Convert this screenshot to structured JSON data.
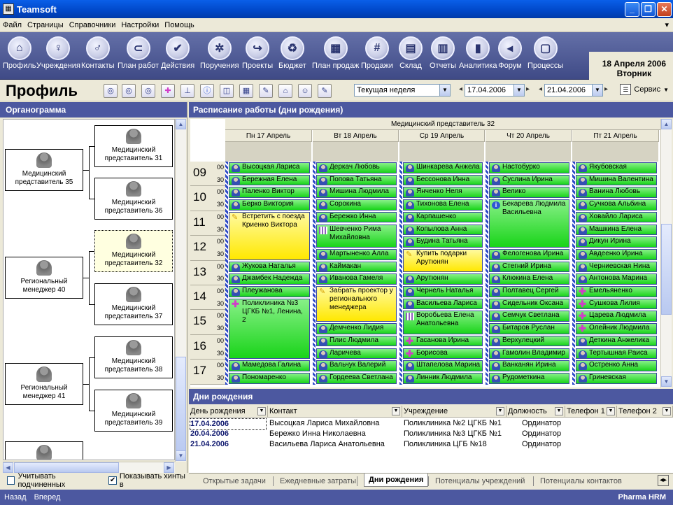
{
  "window": {
    "title": "Teamsoft",
    "minimize": "_",
    "restore": "❐",
    "close": "✕"
  },
  "menu": [
    "Файл",
    "Страницы",
    "Справочники",
    "Настройки",
    "Помощь"
  ],
  "toolbar": [
    {
      "label": "Профиль",
      "icon": "home-icon",
      "glyph": "⌂"
    },
    {
      "label": "Учреждения",
      "icon": "people-icon",
      "glyph": "♀"
    },
    {
      "label": "Контакты",
      "icon": "person-walk-icon",
      "glyph": "♂"
    },
    {
      "label": "План работ",
      "icon": "paperclip-icon",
      "glyph": "⊂"
    },
    {
      "label": "Действия",
      "icon": "checkmark-icon",
      "glyph": "✔"
    },
    {
      "label": "Поручения",
      "icon": "gears-icon",
      "glyph": "✲"
    },
    {
      "label": "Проекты",
      "icon": "arrow-icon",
      "glyph": "↪"
    },
    {
      "label": "Бюджет",
      "icon": "recycle-icon",
      "glyph": "♻"
    },
    {
      "label": "План продаж",
      "icon": "grid-icon",
      "glyph": "▦"
    },
    {
      "label": "Продажи",
      "icon": "hash-icon",
      "glyph": "#"
    },
    {
      "label": "Склад",
      "icon": "cabinet-icon",
      "glyph": "▤"
    },
    {
      "label": "Отчеты",
      "icon": "document-icon",
      "glyph": "▥"
    },
    {
      "label": "Аналитика",
      "icon": "bar-chart-icon",
      "glyph": "▮"
    },
    {
      "label": "Форум",
      "icon": "megaphone-icon",
      "glyph": "◂"
    },
    {
      "label": "Процессы",
      "icon": "film-icon",
      "glyph": "▢"
    }
  ],
  "date": {
    "line1": "18 Апреля 2006",
    "line2": "Вторник"
  },
  "page_title": "Профиль",
  "period": {
    "value": "Текущая неделя",
    "from": "17.04.2006",
    "to": "21.04.2006"
  },
  "service_label": "Сервис",
  "org": {
    "title": "Органограмма",
    "nodes": [
      {
        "label": "Медицинский представитель 35"
      },
      {
        "label": "Медицинский представитель 31"
      },
      {
        "label": "Медицинский представитель 36"
      },
      {
        "label": "Медицинский представитель 32"
      },
      {
        "label": "Региональный менеджер 40"
      },
      {
        "label": "Медицинский представитель 37"
      },
      {
        "label": "Медицинский представитель 38"
      },
      {
        "label": "Региональный менеджер 41"
      },
      {
        "label": "Медицинский представитель 39"
      }
    ],
    "check1": "Учитывать подчиненных",
    "check2": "Показывать хинты в",
    "check2_checked": "✔"
  },
  "schedule": {
    "title": "Расписание работы (дни рождения)",
    "resource": "Медицинский представитель 32",
    "days": [
      "Пн 17 Апрель",
      "Вт 18 Апрель",
      "Ср 19 Апрель",
      "Чт 20 Апрель",
      "Пт 21 Апрель"
    ],
    "hours": [
      "09",
      "10",
      "11",
      "12",
      "13",
      "14",
      "15",
      "16",
      "17"
    ],
    "min00": "00",
    "min30": "30",
    "appointments": [
      [
        {
          "slot": 0,
          "len": 1,
          "text": "Высоцкая Лариса",
          "k": "p"
        },
        {
          "slot": 1,
          "len": 1,
          "text": "Бережная Елена",
          "k": "p"
        },
        {
          "slot": 2,
          "len": 1,
          "text": "Паленко Виктор",
          "k": "p"
        },
        {
          "slot": 3,
          "len": 1,
          "text": "Берко Виктория",
          "k": "p"
        },
        {
          "slot": 4,
          "len": 4,
          "text": "Встретить с поезда Криенко Виктора",
          "k": "t",
          "y": true
        },
        {
          "slot": 8,
          "len": 1,
          "text": "Жукова Наталья",
          "k": "p"
        },
        {
          "slot": 9,
          "len": 1,
          "text": "Джамбек Надежда",
          "k": "p"
        },
        {
          "slot": 10,
          "len": 1,
          "text": "Плеужанова",
          "k": "p"
        },
        {
          "slot": 11,
          "len": 5,
          "text": "Поликлиника №3 ЦГКБ №1, Ленина, 2",
          "k": "c",
          "tall": true
        },
        {
          "slot": 16,
          "len": 1,
          "text": "Мамедова Галина",
          "k": "p"
        },
        {
          "slot": 17,
          "len": 1,
          "text": "Пономаренко",
          "k": "p"
        }
      ],
      [
        {
          "slot": 0,
          "len": 1,
          "text": "Деркач Любовь",
          "k": "p"
        },
        {
          "slot": 1,
          "len": 1,
          "text": "Попова Татьяна",
          "k": "p"
        },
        {
          "slot": 2,
          "len": 1,
          "text": "Мишина Людмила",
          "k": "p"
        },
        {
          "slot": 3,
          "len": 1,
          "text": "Сорокина",
          "k": "p"
        },
        {
          "slot": 4,
          "len": 1,
          "text": "Бережко Инна",
          "k": "p"
        },
        {
          "slot": 5,
          "len": 2,
          "text": "Шевченко Рима Михайловна",
          "k": "g",
          "tall": true
        },
        {
          "slot": 7,
          "len": 1,
          "text": "Мартыненко Алла",
          "k": "p"
        },
        {
          "slot": 8,
          "len": 1,
          "text": "Каймакан",
          "k": "p"
        },
        {
          "slot": 9,
          "len": 1,
          "text": "Иванова Гамеля",
          "k": "p"
        },
        {
          "slot": 10,
          "len": 3,
          "text": "Забрать проектор у регионального менеджера",
          "k": "t",
          "y": true
        },
        {
          "slot": 13,
          "len": 1,
          "text": "Демченко Лидия",
          "k": "p"
        },
        {
          "slot": 14,
          "len": 1,
          "text": "Плис Людмила",
          "k": "p"
        },
        {
          "slot": 15,
          "len": 1,
          "text": "Ларичева",
          "k": "p"
        },
        {
          "slot": 16,
          "len": 1,
          "text": "Вальчук Валерий",
          "k": "p"
        },
        {
          "slot": 17,
          "len": 1,
          "text": "Гордеева Светлана",
          "k": "p"
        }
      ],
      [
        {
          "slot": 0,
          "len": 1,
          "text": "Шинкарева Анжела",
          "k": "p"
        },
        {
          "slot": 1,
          "len": 1,
          "text": "Бессонова Инна",
          "k": "p"
        },
        {
          "slot": 2,
          "len": 1,
          "text": "Янченко Неля",
          "k": "p"
        },
        {
          "slot": 3,
          "len": 1,
          "text": "Тихонова Елена",
          "k": "p"
        },
        {
          "slot": 4,
          "len": 1,
          "text": "Карпашенко",
          "k": "p"
        },
        {
          "slot": 5,
          "len": 1,
          "text": "Копылова Анна",
          "k": "p"
        },
        {
          "slot": 6,
          "len": 1,
          "text": "Будина Татьяна",
          "k": "p"
        },
        {
          "slot": 7,
          "len": 2,
          "text": "Купить подарки Арутюнян",
          "k": "t",
          "y": true
        },
        {
          "slot": 9,
          "len": 1,
          "text": "Арутюнян",
          "k": "p"
        },
        {
          "slot": 10,
          "len": 1,
          "text": "Чернель Наталья",
          "k": "p"
        },
        {
          "slot": 11,
          "len": 1,
          "text": "Васильева Лариса",
          "k": "p"
        },
        {
          "slot": 12,
          "len": 2,
          "text": "Воробьева Елена Анатольевна",
          "k": "g",
          "tall": true
        },
        {
          "slot": 14,
          "len": 1,
          "text": "Гасанова Ирина",
          "k": "c"
        },
        {
          "slot": 15,
          "len": 1,
          "text": "Борисова",
          "k": "c"
        },
        {
          "slot": 16,
          "len": 1,
          "text": "Штапелова Марина",
          "k": "p"
        },
        {
          "slot": 17,
          "len": 1,
          "text": "Линник Людмила",
          "k": "p"
        }
      ],
      [
        {
          "slot": 0,
          "len": 1,
          "text": "Настобурко",
          "k": "p"
        },
        {
          "slot": 1,
          "len": 1,
          "text": "Суслина Ирина",
          "k": "p"
        },
        {
          "slot": 2,
          "len": 1,
          "text": "Велико",
          "k": "p"
        },
        {
          "slot": 3,
          "len": 4,
          "text": "Бекарева Людмила Васильевна",
          "k": "i",
          "tall": true
        },
        {
          "slot": 7,
          "len": 1,
          "text": "Фелогенова Ирина",
          "k": "p"
        },
        {
          "slot": 8,
          "len": 1,
          "text": "Стегний Ирина",
          "k": "p"
        },
        {
          "slot": 9,
          "len": 1,
          "text": "Клюкина Елена",
          "k": "p"
        },
        {
          "slot": 10,
          "len": 1,
          "text": "Полтавец Сергей",
          "k": "p"
        },
        {
          "slot": 11,
          "len": 1,
          "text": "Сидельник Оксана",
          "k": "p"
        },
        {
          "slot": 12,
          "len": 1,
          "text": "Семчук Светлана",
          "k": "p"
        },
        {
          "slot": 13,
          "len": 1,
          "text": "Битаров Руслан",
          "k": "p"
        },
        {
          "slot": 14,
          "len": 1,
          "text": "Верхулецкий",
          "k": "p"
        },
        {
          "slot": 15,
          "len": 1,
          "text": "Гамолин Владимир",
          "k": "p"
        },
        {
          "slot": 16,
          "len": 1,
          "text": "Ванканян Ирина",
          "k": "p"
        },
        {
          "slot": 17,
          "len": 1,
          "text": "Рудометкина",
          "k": "p"
        }
      ],
      [
        {
          "slot": 0,
          "len": 1,
          "text": "Якубовская",
          "k": "p"
        },
        {
          "slot": 1,
          "len": 1,
          "text": "Мишина Валентина",
          "k": "p"
        },
        {
          "slot": 2,
          "len": 1,
          "text": "Ванина Любовь",
          "k": "p"
        },
        {
          "slot": 3,
          "len": 1,
          "text": "Сучкова Альбина",
          "k": "p"
        },
        {
          "slot": 4,
          "len": 1,
          "text": "Ховайло Лариса",
          "k": "p"
        },
        {
          "slot": 5,
          "len": 1,
          "text": "Машкина Елена",
          "k": "p"
        },
        {
          "slot": 6,
          "len": 1,
          "text": "Дикун Ирина",
          "k": "p"
        },
        {
          "slot": 7,
          "len": 1,
          "text": "Авдеенко Ирина",
          "k": "p"
        },
        {
          "slot": 8,
          "len": 1,
          "text": "Черниевская Нина",
          "k": "p"
        },
        {
          "slot": 9,
          "len": 1,
          "text": "Антонова Марина",
          "k": "p"
        },
        {
          "slot": 10,
          "len": 1,
          "text": "Емельяненко",
          "k": "c"
        },
        {
          "slot": 11,
          "len": 1,
          "text": "Сушкова Лилия",
          "k": "c"
        },
        {
          "slot": 12,
          "len": 1,
          "text": "Царева Людмила",
          "k": "c"
        },
        {
          "slot": 13,
          "len": 1,
          "text": "Олейник Людмила",
          "k": "c"
        },
        {
          "slot": 14,
          "len": 1,
          "text": "Деткина Анжелика",
          "k": "p"
        },
        {
          "slot": 15,
          "len": 1,
          "text": "Тертышная Раиса",
          "k": "p"
        },
        {
          "slot": 16,
          "len": 1,
          "text": "Остренко Анна",
          "k": "p"
        },
        {
          "slot": 17,
          "len": 1,
          "text": "Гриневская",
          "k": "p"
        }
      ]
    ]
  },
  "birthdays": {
    "title": "Дни рождения",
    "columns": [
      "День рождения",
      "Контакт",
      "Учреждение",
      "Должность",
      "Телефон 1",
      "Телефон 2"
    ],
    "rows": [
      [
        "17.04.2006",
        "Высоцкая Лариса Михайловна",
        "Поликлиника №2 ЦГКБ №1",
        "Ординатор"
      ],
      [
        "20.04.2006",
        "Бережко Инна Николаевна",
        "Поликлиника №3 ЦГКБ №1",
        "Ординатор"
      ],
      [
        "21.04.2006",
        "Васильева Лариса Анатольевна",
        "Поликлиника ЦГБ №18",
        "Ординатор"
      ]
    ]
  },
  "tabs": [
    "Открытые задачи",
    "Ежедневные затраты",
    "Дни рождения",
    "Потенциалы учреждений",
    "Потенциалы контактов"
  ],
  "status": {
    "back": "Назад",
    "forward": "Вперед",
    "product": "Pharma HRM"
  }
}
